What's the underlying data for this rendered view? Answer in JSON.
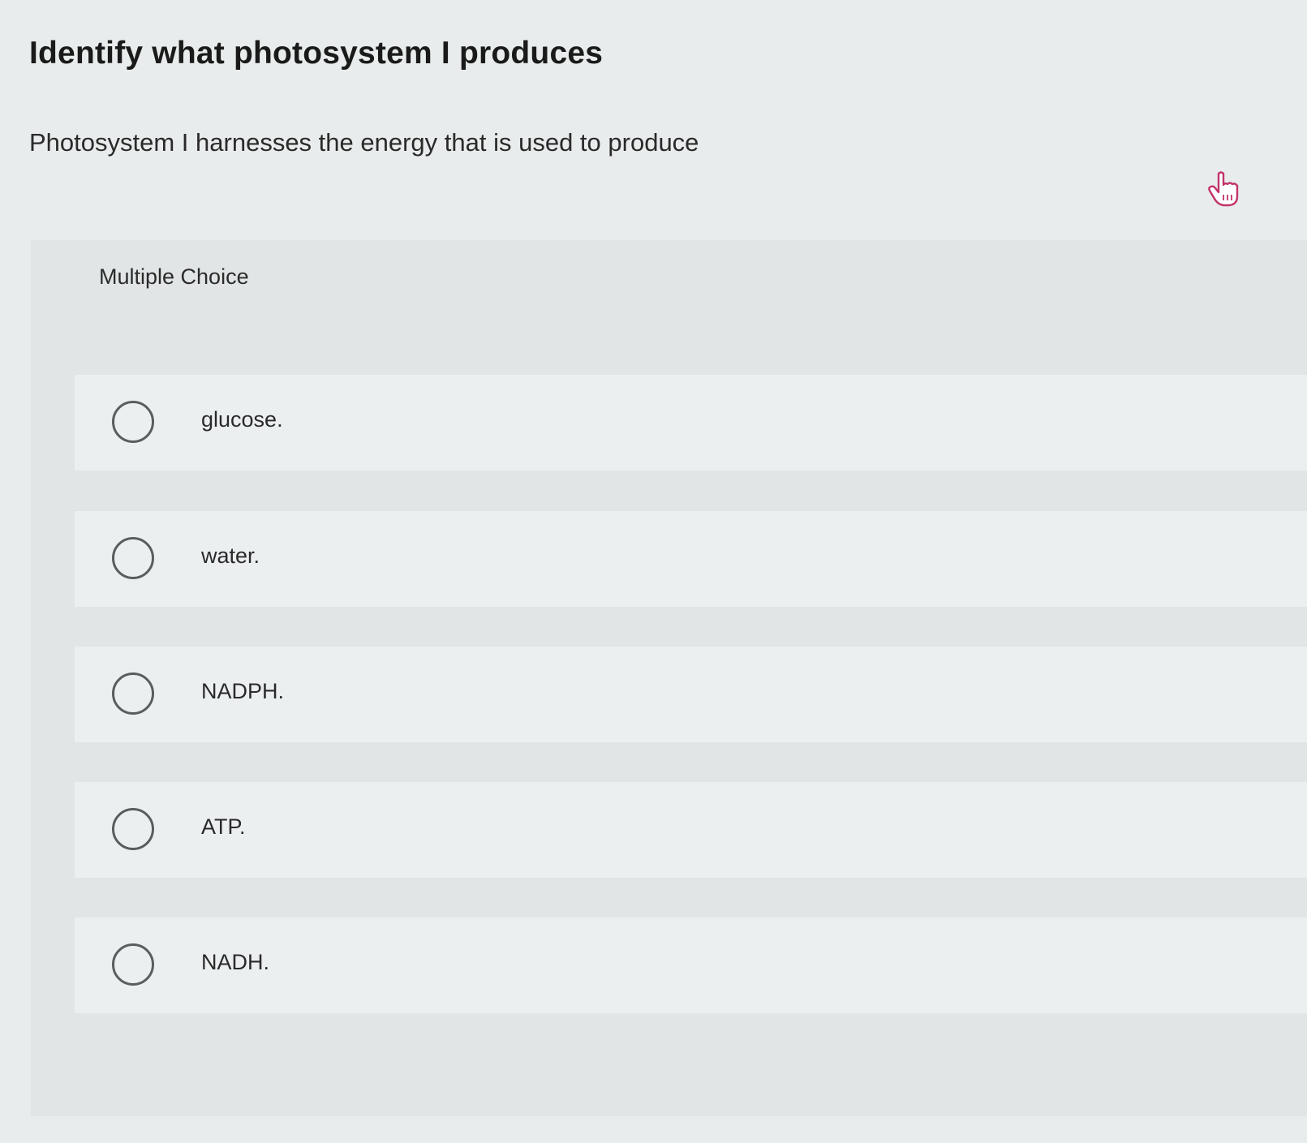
{
  "question": {
    "title": "Identify what photosystem I produces",
    "prompt": "Photosystem I harnesses the energy that is used to produce"
  },
  "multiple_choice": {
    "label": "Multiple Choice",
    "options": [
      {
        "label": "glucose.",
        "selected": false
      },
      {
        "label": "water.",
        "selected": false
      },
      {
        "label": "NADPH.",
        "selected": false
      },
      {
        "label": "ATP.",
        "selected": false
      },
      {
        "label": "NADH.",
        "selected": false
      }
    ]
  },
  "icons": {
    "cursor": "hand-pointer-icon",
    "radio": "radio-unchecked-icon"
  },
  "colors": {
    "background": "#e9ecec",
    "panel": "#e1e5e5",
    "option": "#eceff0",
    "cursor_accent": "#c2336b"
  }
}
